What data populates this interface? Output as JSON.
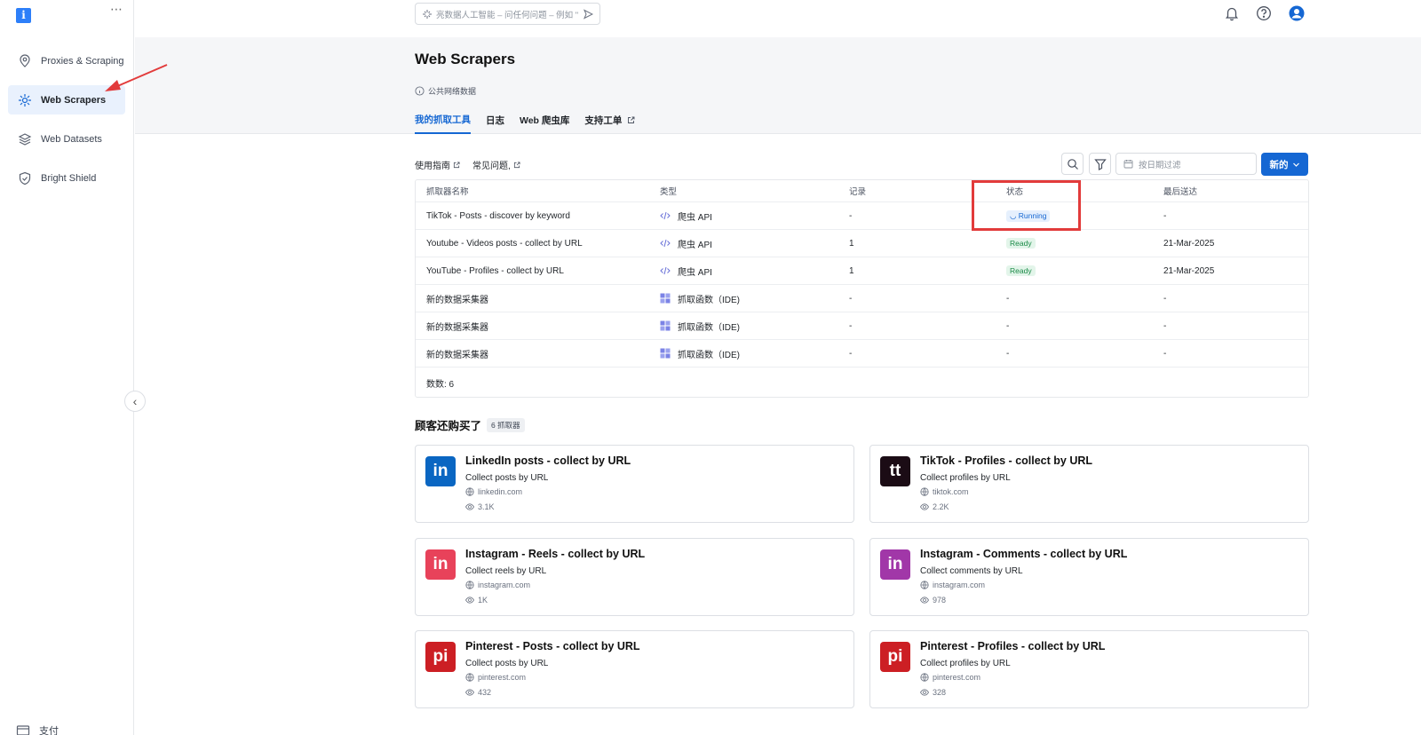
{
  "logo_letter": "i",
  "more_icon": "⋯",
  "sidebar": {
    "items": [
      {
        "label": "Proxies & Scraping",
        "icon": "map-pin-icon"
      },
      {
        "label": "Web Scrapers",
        "icon": "scraper-icon",
        "active": true
      },
      {
        "label": "Web Datasets",
        "icon": "layers-icon"
      },
      {
        "label": "Bright Shield",
        "icon": "shield-icon"
      }
    ],
    "bottom_item": {
      "label": "支付",
      "icon": "billing-icon"
    },
    "collapse_glyph": "‹"
  },
  "topbar": {
    "ai_placeholder": "亮数据人工智能 – 问任何问题 – 例如 \""
  },
  "header": {
    "title": "Web Scrapers",
    "subtitle": "公共网络数据",
    "tabs": [
      {
        "label": "我的抓取工具",
        "active": true
      },
      {
        "label": "日志"
      },
      {
        "label": "Web 爬虫库"
      },
      {
        "label": "支持工单",
        "external": true
      }
    ]
  },
  "links": {
    "guide": "使用指南",
    "faq": "常见问题,"
  },
  "toolbar": {
    "date_placeholder": "按日期过滤",
    "new_label": "新的"
  },
  "table": {
    "headers": [
      "抓取器名称",
      "类型",
      "记录",
      "状态",
      "最后送达"
    ],
    "rows": [
      {
        "name": "TikTok - Posts - discover by keyword",
        "type": "爬虫 API",
        "type_icon": "code-icon",
        "records": "-",
        "status": "Running",
        "status_kind": "running",
        "last": "-"
      },
      {
        "name": "Youtube - Videos posts - collect by URL",
        "type": "爬虫 API",
        "type_icon": "code-icon",
        "records": "1",
        "status": "Ready",
        "status_kind": "ready",
        "last": "21-Mar-2025"
      },
      {
        "name": "YouTube - Profiles - collect by URL",
        "type": "爬虫 API",
        "type_icon": "code-icon",
        "records": "1",
        "status": "Ready",
        "status_kind": "ready",
        "last": "21-Mar-2025"
      },
      {
        "name": "新的数据采集器",
        "type": "抓取函数（IDE)",
        "type_icon": "grid-icon",
        "records": "-",
        "status": "-",
        "status_kind": "none",
        "last": "-"
      },
      {
        "name": "新的数据采集器",
        "type": "抓取函数（IDE)",
        "type_icon": "grid-icon",
        "records": "-",
        "status": "-",
        "status_kind": "none",
        "last": "-"
      },
      {
        "name": "新的数据采集器",
        "type": "抓取函数（IDE)",
        "type_icon": "grid-icon",
        "records": "-",
        "status": "-",
        "status_kind": "none",
        "last": "-"
      }
    ],
    "count_label": "数数: 6"
  },
  "section": {
    "title": "顾客还购买了",
    "badge": "6 抓取器"
  },
  "cards": [
    {
      "logo": "in",
      "color": "#0a66c2",
      "title": "LinkedIn posts - collect by URL",
      "desc": "Collect posts by URL",
      "domain": "linkedin.com",
      "views": "3.1K"
    },
    {
      "logo": "tt",
      "color": "#1b0c15",
      "title": "TikTok - Profiles - collect by URL",
      "desc": "Collect profiles by URL",
      "domain": "tiktok.com",
      "views": "2.2K"
    },
    {
      "logo": "in",
      "color": "#e8425a",
      "title": "Instagram - Reels - collect by URL",
      "desc": "Collect reels by URL",
      "domain": "instagram.com",
      "views": "1K"
    },
    {
      "logo": "in",
      "color": "#a137a8",
      "title": "Instagram - Comments - collect by URL",
      "desc": "Collect comments by URL",
      "domain": "instagram.com",
      "views": "978"
    },
    {
      "logo": "pi",
      "color": "#cc1f24",
      "title": "Pinterest - Posts - collect by URL",
      "desc": "Collect posts by URL",
      "domain": "pinterest.com",
      "views": "432"
    },
    {
      "logo": "pi",
      "color": "#cc1f24",
      "title": "Pinterest - Profiles - collect by URL",
      "desc": "Collect profiles by URL",
      "domain": "pinterest.com",
      "views": "328"
    }
  ],
  "colors": {
    "accent": "#1567d3",
    "annotation": "#e23b3b"
  }
}
